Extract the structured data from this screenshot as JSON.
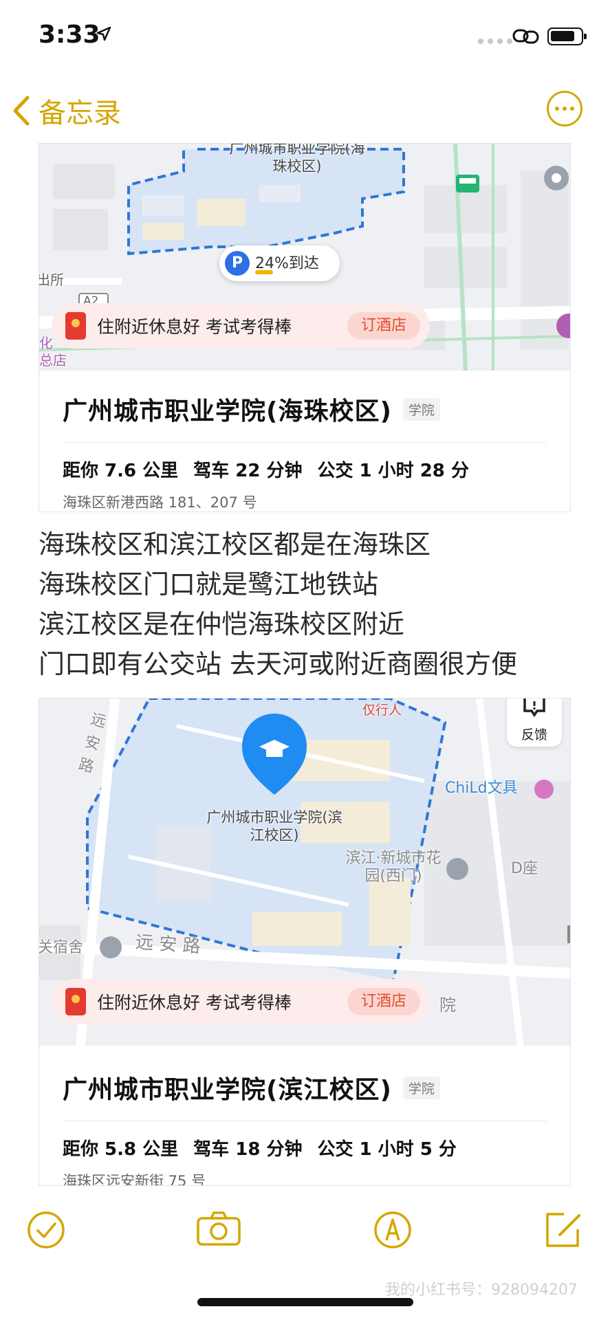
{
  "status_bar": {
    "time": "3:33"
  },
  "nav": {
    "back_label": "备忘录"
  },
  "card1": {
    "map_labels": {
      "campus": "广州城市职业学院(海珠校区)",
      "left_a": "出所",
      "left_b": "化",
      "left_c": "总店",
      "road_code": "A2"
    },
    "parking_text": "24%到达",
    "ad_text": "住附近休息好 考试考得棒",
    "ad_button": "订酒店",
    "title": "广州城市职业学院(海珠校区)",
    "tag": "学院",
    "distance": "距你 7.6 公里",
    "drive": "驾车 22 分钟",
    "bus": "公交 1 小时 28 分",
    "address": "海珠区新港西路 181、207 号"
  },
  "note_lines": [
    "海珠校区和滨江校区都是在海珠区",
    "海珠校区门口就是鹭江地铁站",
    "滨江校区是在仲恺海珠校区附近",
    "门口即有公交站 去天河或附近商圈很方便"
  ],
  "card2": {
    "map_labels": {
      "campus": "广州城市职业学院(滨江校区)",
      "road_left": "远安路",
      "road_bottom": "远 安 路",
      "yixingren": "仅行人",
      "child_store": "ChiLd文具",
      "garden": "滨江·新城市花园(西门)",
      "d_seat": "D座",
      "dorm": "关宿舍",
      "school_right": "院"
    },
    "feedback_label": "反馈",
    "ad_text": "住附近休息好 考试考得棒",
    "ad_button": "订酒店",
    "title": "广州城市职业学院(滨江校区)",
    "tag": "学院",
    "distance": "距你 5.8 公里",
    "drive": "驾车 18 分钟",
    "bus": "公交 1 小时 5 分",
    "address": "海珠区远安新街 75 号"
  },
  "watermark": "我的小红书号：928094207",
  "colors": {
    "accent": "#d4a600",
    "campus_fill": "#d6e4f5",
    "boundary": "#2f76d6"
  },
  "icons": [
    "location-arrow-icon",
    "link-icon",
    "battery-icon",
    "chevron-left-icon",
    "more-icon",
    "checklist-icon",
    "camera-icon",
    "markup-icon",
    "compose-icon"
  ]
}
